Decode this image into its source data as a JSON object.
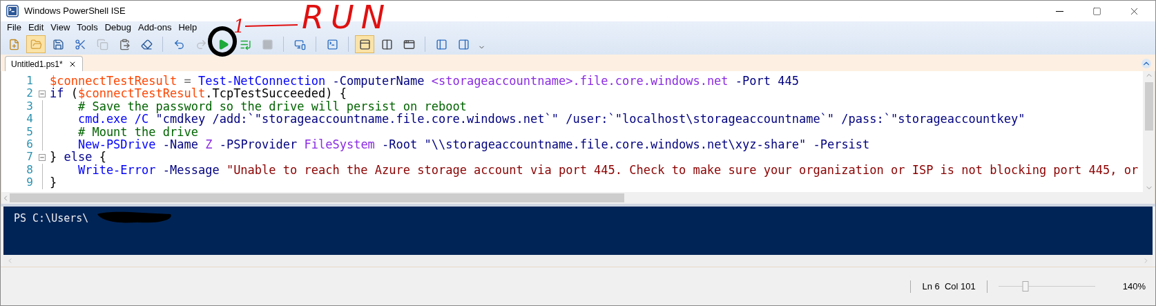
{
  "window": {
    "title": "Windows PowerShell ISE"
  },
  "menu": [
    "File",
    "Edit",
    "View",
    "Tools",
    "Debug",
    "Add-ons",
    "Help"
  ],
  "toolbar": [
    {
      "kind": "new",
      "disabled": false,
      "highlighted": false
    },
    {
      "kind": "open",
      "disabled": false,
      "highlighted": true
    },
    {
      "kind": "save",
      "disabled": false,
      "highlighted": false
    },
    {
      "kind": "cut",
      "disabled": false,
      "highlighted": false
    },
    {
      "kind": "copy",
      "disabled": true,
      "highlighted": false
    },
    {
      "kind": "paste",
      "disabled": false,
      "highlighted": false
    },
    {
      "kind": "clear",
      "disabled": false,
      "highlighted": false
    },
    {
      "kind": "sep"
    },
    {
      "kind": "undo",
      "disabled": false,
      "highlighted": false
    },
    {
      "kind": "redo",
      "disabled": true,
      "highlighted": false
    },
    {
      "kind": "run",
      "disabled": false,
      "highlighted": false
    },
    {
      "kind": "runsel",
      "disabled": false,
      "highlighted": false
    },
    {
      "kind": "stop",
      "disabled": true,
      "highlighted": false
    },
    {
      "kind": "sep"
    },
    {
      "kind": "remote",
      "disabled": false,
      "highlighted": false
    },
    {
      "kind": "sep"
    },
    {
      "kind": "console",
      "disabled": false,
      "highlighted": false
    },
    {
      "kind": "sep"
    },
    {
      "kind": "layouttop",
      "disabled": false,
      "highlighted": true
    },
    {
      "kind": "layoutright",
      "disabled": false,
      "highlighted": false
    },
    {
      "kind": "layoutmax",
      "disabled": false,
      "highlighted": false
    },
    {
      "kind": "sep"
    },
    {
      "kind": "scriptpane",
      "disabled": false,
      "highlighted": false
    },
    {
      "kind": "addon",
      "disabled": false,
      "highlighted": false
    }
  ],
  "annotation": {
    "step": "1",
    "label": "RUN"
  },
  "tabs": [
    {
      "label": "Untitled1.ps1*",
      "selected": true
    }
  ],
  "editor": {
    "lines": [
      {
        "number": "1",
        "fold": false,
        "tokens": [
          {
            "t": "$connectTestResult",
            "kind": "var"
          },
          {
            "t": " = ",
            "kind": "op"
          },
          {
            "t": "Test-NetConnection",
            "kind": "cmd"
          },
          {
            "t": " -ComputerName",
            "kind": "param"
          },
          {
            "t": " <storageaccountname>.file.core.windows.net",
            "kind": "arg"
          },
          {
            "t": " -Port",
            "kind": "param"
          },
          {
            "t": " 445",
            "kind": "param"
          }
        ]
      },
      {
        "number": "2",
        "fold": true,
        "tokens": [
          {
            "t": "if",
            "kind": "kw"
          },
          {
            "t": " (",
            "kind": "plain"
          },
          {
            "t": "$connectTestResult",
            "kind": "var"
          },
          {
            "t": ".TcpTestSucceeded) {",
            "kind": "plain"
          }
        ]
      },
      {
        "number": "3",
        "fold": false,
        "tokens": [
          {
            "t": "    # Save the password so the drive will persist on reboot",
            "kind": "comment"
          }
        ]
      },
      {
        "number": "4",
        "fold": false,
        "tokens": [
          {
            "t": "    cmd.exe",
            "kind": "cmd"
          },
          {
            "t": " /C",
            "kind": "cmd"
          },
          {
            "t": " \"cmdkey /add:`\"storageaccountname.file.core.windows.net`\" /user:`\"localhost\\storageaccountname`\" /pass:`\"storageaccountkey\"",
            "kind": "param"
          }
        ]
      },
      {
        "number": "5",
        "fold": false,
        "tokens": [
          {
            "t": "    # Mount the drive",
            "kind": "comment"
          }
        ]
      },
      {
        "number": "6",
        "fold": false,
        "tokens": [
          {
            "t": "    New-PSDrive",
            "kind": "cmd"
          },
          {
            "t": " -Name",
            "kind": "param"
          },
          {
            "t": " Z",
            "kind": "arg"
          },
          {
            "t": " -PSProvider",
            "kind": "param"
          },
          {
            "t": " FileSystem",
            "kind": "arg"
          },
          {
            "t": " -Root",
            "kind": "param"
          },
          {
            "t": " \"\\\\storageaccountname.file.core.windows.net\\xyz-share\"",
            "kind": "param"
          },
          {
            "t": " -Persist",
            "kind": "param"
          }
        ]
      },
      {
        "number": "7",
        "fold": true,
        "tokens": [
          {
            "t": "} ",
            "kind": "plain"
          },
          {
            "t": "else",
            "kind": "kw"
          },
          {
            "t": " {",
            "kind": "plain"
          }
        ]
      },
      {
        "number": "8",
        "fold": false,
        "tokens": [
          {
            "t": "    Write-Error",
            "kind": "cmd"
          },
          {
            "t": " -Message",
            "kind": "param"
          },
          {
            "t": " \"Unable to reach the Azure storage account via port 445. Check to make sure your organization or ISP is not blocking port 445, or",
            "kind": "string"
          }
        ]
      },
      {
        "number": "9",
        "fold": false,
        "tokens": [
          {
            "t": "}",
            "kind": "plain"
          }
        ]
      }
    ]
  },
  "console": {
    "prompt": "PS C:\\Users\\"
  },
  "status_bar": {
    "position": "Ln 6  Col 101",
    "zoom": {
      "level": 0.28,
      "reading": "140%"
    }
  }
}
